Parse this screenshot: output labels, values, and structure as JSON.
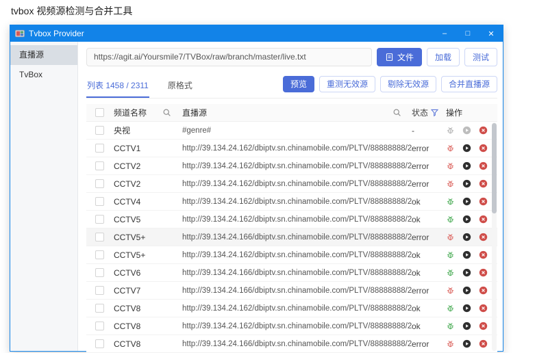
{
  "page": {
    "title": "tvbox 视频源检测与合并工具"
  },
  "window": {
    "title": "Tvbox Provider",
    "controls": {
      "minimize": "–",
      "maximize": "□",
      "close": "✕"
    }
  },
  "sidebar": {
    "items": [
      {
        "label": "直播源",
        "active": true
      },
      {
        "label": "TvBox",
        "active": false
      }
    ]
  },
  "toolbar": {
    "url_value": "https://agit.ai/Yoursmile7/TVBox/raw/branch/master/live.txt",
    "file_button": "文件",
    "load_button": "加载",
    "test_button": "测试"
  },
  "tabs": [
    {
      "label": "列表 1458 / 2311",
      "active": true
    },
    {
      "label": "原格式",
      "active": false
    }
  ],
  "actions": {
    "preview": "预览",
    "retest_invalid": "重测无效源",
    "remove_invalid": "剔除无效源",
    "merge_sources": "合并直播源"
  },
  "table": {
    "headers": {
      "channel": "频道名称",
      "source": "直播源",
      "status": "状态",
      "ops": "操作"
    },
    "rows": [
      {
        "name": "央视",
        "source": "#genre#",
        "status": "-",
        "state": "none",
        "highlight": false
      },
      {
        "name": "CCTV1",
        "source": "http://39.134.24.162/dbiptv.sn.chinamobile.com/PLTV/88888888/2...",
        "status": "error",
        "state": "error",
        "highlight": false
      },
      {
        "name": "CCTV2",
        "source": "http://39.134.24.162/dbiptv.sn.chinamobile.com/PLTV/88888888/2...",
        "status": "error",
        "state": "error",
        "highlight": false
      },
      {
        "name": "CCTV2",
        "source": "http://39.134.24.162/dbiptv.sn.chinamobile.com/PLTV/88888888/2...",
        "status": "error",
        "state": "error",
        "highlight": false
      },
      {
        "name": "CCTV4",
        "source": "http://39.134.24.162/dbiptv.sn.chinamobile.com/PLTV/88888888/2...",
        "status": "ok",
        "state": "ok",
        "highlight": false
      },
      {
        "name": "CCTV5",
        "source": "http://39.134.24.162/dbiptv.sn.chinamobile.com/PLTV/88888888/2...",
        "status": "ok",
        "state": "ok",
        "highlight": false
      },
      {
        "name": "CCTV5+",
        "source": "http://39.134.24.166/dbiptv.sn.chinamobile.com/PLTV/88888888/2...",
        "status": "error",
        "state": "error",
        "highlight": true
      },
      {
        "name": "CCTV5+",
        "source": "http://39.134.24.162/dbiptv.sn.chinamobile.com/PLTV/88888888/2...",
        "status": "ok",
        "state": "ok",
        "highlight": false
      },
      {
        "name": "CCTV6",
        "source": "http://39.134.24.166/dbiptv.sn.chinamobile.com/PLTV/88888888/2...",
        "status": "ok",
        "state": "ok",
        "highlight": false
      },
      {
        "name": "CCTV7",
        "source": "http://39.134.24.166/dbiptv.sn.chinamobile.com/PLTV/88888888/2...",
        "status": "error",
        "state": "error",
        "highlight": false
      },
      {
        "name": "CCTV8",
        "source": "http://39.134.24.162/dbiptv.sn.chinamobile.com/PLTV/88888888/2...",
        "status": "ok",
        "state": "ok",
        "highlight": false
      },
      {
        "name": "CCTV8",
        "source": "http://39.134.24.162/dbiptv.sn.chinamobile.com/PLTV/88888888/2...",
        "status": "ok",
        "state": "ok",
        "highlight": false
      },
      {
        "name": "CCTV8",
        "source": "http://39.134.24.166/dbiptv.sn.chinamobile.com/PLTV/88888888/2...",
        "status": "error",
        "state": "error",
        "highlight": false
      }
    ]
  },
  "colors": {
    "accent": "#4a6cd8",
    "titlebar_blue": "#1283e8",
    "error_icon": "#dd6b66",
    "ok_icon": "#53b05e",
    "delete_red": "#cf4d49",
    "play_dark": "#2f2f2f"
  }
}
